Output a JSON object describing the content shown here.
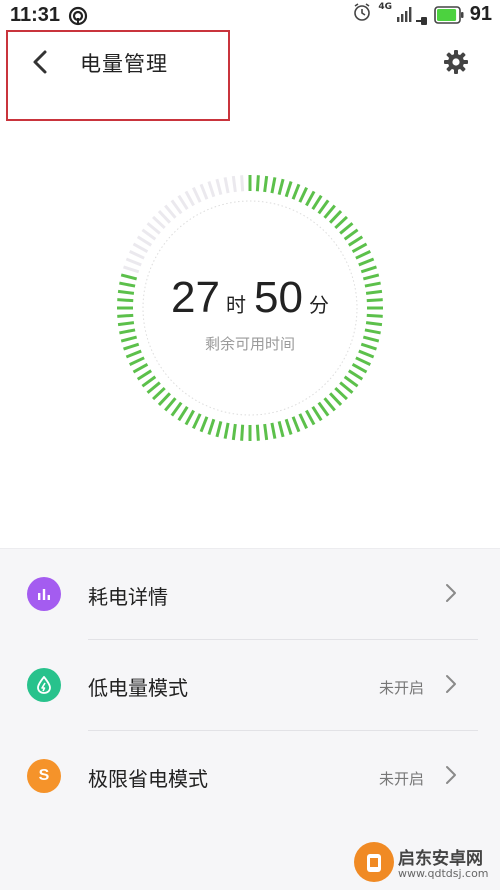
{
  "status_bar": {
    "time": "11:31",
    "network_label": "4G",
    "battery_level": "91",
    "battery_fraction": 0.91
  },
  "header": {
    "title": "电量管理"
  },
  "gauge": {
    "hours": "27",
    "hours_unit": "时",
    "minutes": "50",
    "minutes_unit": "分",
    "label": "剩余可用时间",
    "level": 0.8
  },
  "list": {
    "items": [
      {
        "label": "耗电详情",
        "status": "",
        "icon": "bar-chart-icon",
        "color": "#a45cf0"
      },
      {
        "label": "低电量模式",
        "status": "未开启",
        "icon": "leaf-drop-icon",
        "color": "#28c28c"
      },
      {
        "label": "极限省电模式",
        "status": "未开启",
        "icon": "s-letter-icon",
        "icon_text": "S",
        "color": "#f5932a"
      }
    ]
  },
  "watermark": {
    "name": "启东安卓网",
    "url": "www.qdtdsj.com"
  },
  "colors": {
    "gauge_active": "#5cc04b",
    "gauge_inactive": "#ebe9ee"
  }
}
